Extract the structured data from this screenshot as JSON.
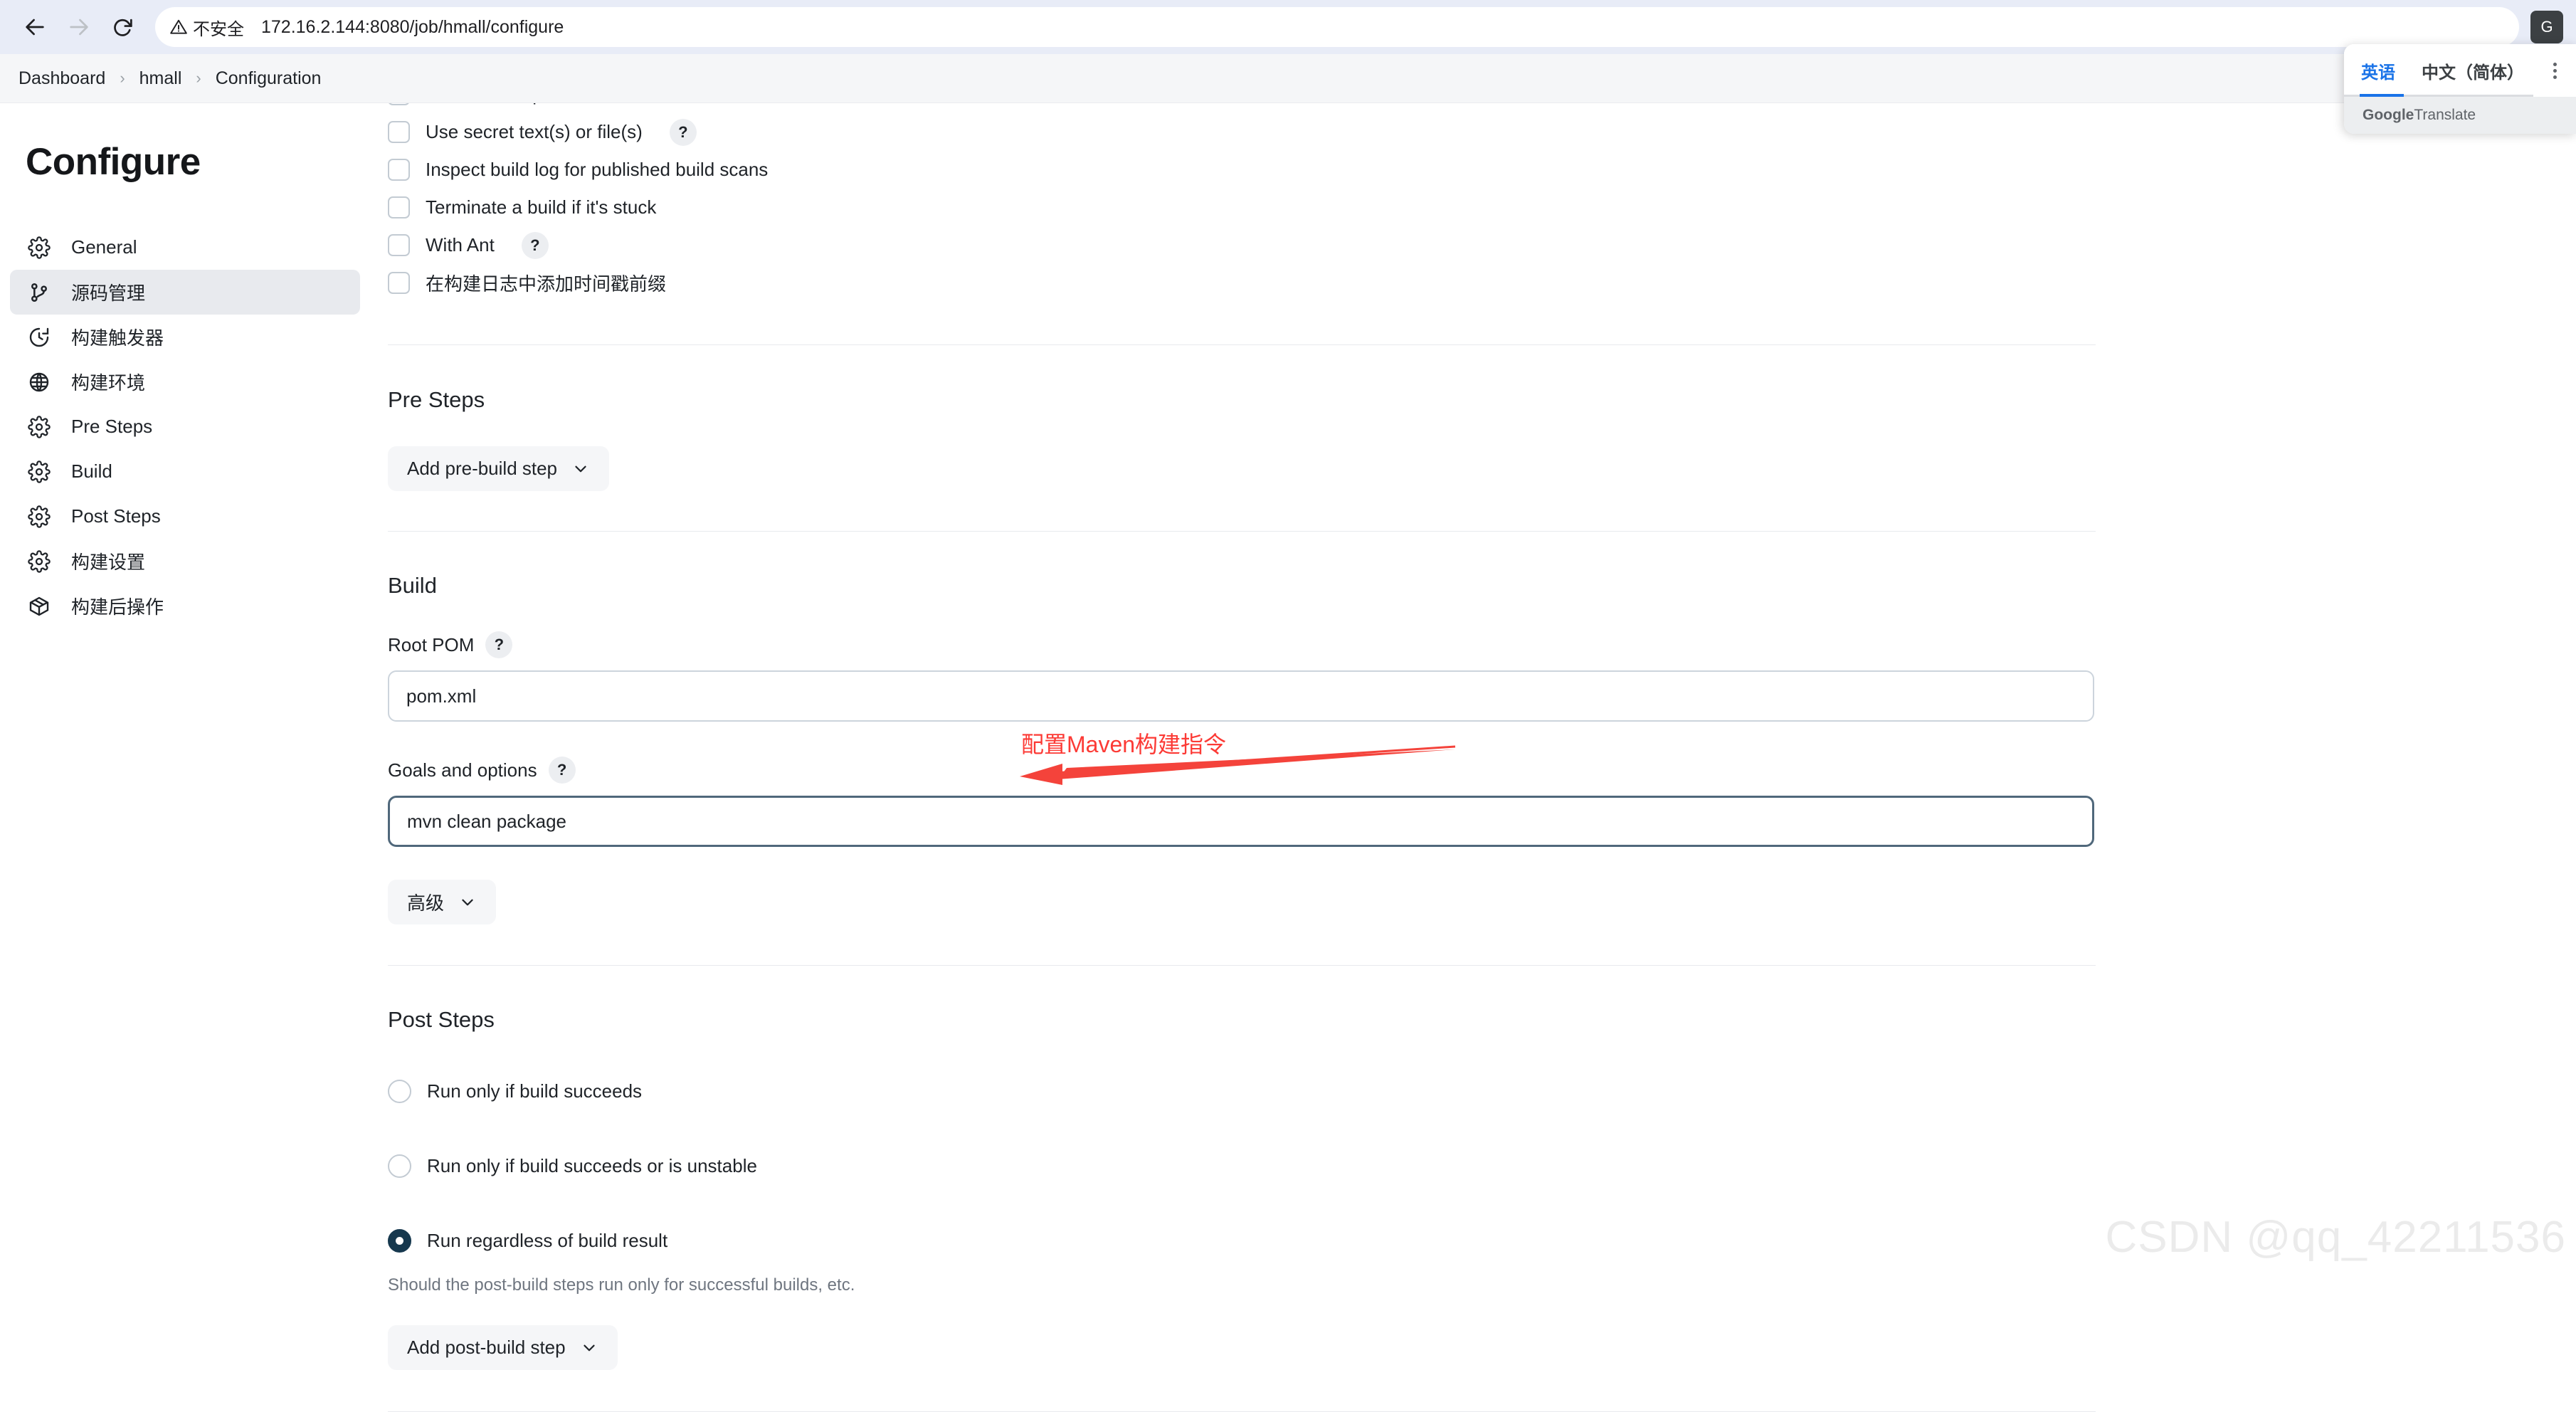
{
  "browser": {
    "back_icon": "back-arrow-icon",
    "forward_icon": "forward-arrow-icon",
    "reload_icon": "reload-icon",
    "security_label": "不安全",
    "security_icon": "warning-triangle-icon",
    "url": "172.16.2.144:8080/job/hmall/configure",
    "profile_initial": "G"
  },
  "breadcrumb": {
    "items": [
      "Dashboard",
      "hmall",
      "Configuration"
    ],
    "separator": "›"
  },
  "sidebar": {
    "title": "Configure",
    "items": [
      {
        "label": "General",
        "icon": "gear-icon",
        "active": false
      },
      {
        "label": "源码管理",
        "icon": "source-branch-icon",
        "active": true
      },
      {
        "label": "构建触发器",
        "icon": "clock-icon",
        "active": false
      },
      {
        "label": "构建环境",
        "icon": "globe-icon",
        "active": false
      },
      {
        "label": "Pre Steps",
        "icon": "gear-icon",
        "active": false
      },
      {
        "label": "Build",
        "icon": "gear-icon",
        "active": false
      },
      {
        "label": "Post Steps",
        "icon": "gear-icon",
        "active": false
      },
      {
        "label": "构建设置",
        "icon": "gear-icon",
        "active": false
      },
      {
        "label": "构建后操作",
        "icon": "package-icon",
        "active": false
      }
    ]
  },
  "build_env": {
    "checkboxes": [
      {
        "label": "Delete workspace before build starts",
        "checked": false,
        "help": false
      },
      {
        "label": "Use secret text(s) or file(s)",
        "checked": false,
        "help": true
      },
      {
        "label": "Inspect build log for published build scans",
        "checked": false,
        "help": false
      },
      {
        "label": "Terminate a build if it's stuck",
        "checked": false,
        "help": false
      },
      {
        "label": "With Ant",
        "checked": false,
        "help": true
      },
      {
        "label": "在构建日志中添加时间戳前缀",
        "checked": false,
        "help": false
      }
    ]
  },
  "pre_steps": {
    "heading": "Pre Steps",
    "add_button": "Add pre-build step",
    "caret_icon": "chevron-down-icon"
  },
  "build": {
    "heading": "Build",
    "root_pom": {
      "label": "Root POM",
      "value": "pom.xml",
      "help": "?"
    },
    "goals": {
      "label": "Goals and options",
      "value": "mvn clean package",
      "help": "?"
    },
    "advanced_button": "高级"
  },
  "post_steps": {
    "heading": "Post Steps",
    "options": [
      {
        "label": "Run only if build succeeds",
        "selected": false
      },
      {
        "label": "Run only if build succeeds or is unstable",
        "selected": false
      },
      {
        "label": "Run regardless of build result",
        "selected": true
      }
    ],
    "hint": "Should the post-build steps run only for successful builds, etc.",
    "add_button": "Add post-build step"
  },
  "annotation": {
    "text": "配置Maven构建指令",
    "color": "#fc3a35"
  },
  "google_translate": {
    "tab_source": "英语",
    "tab_target": "中文（简体）",
    "footer_brand": "Google",
    "footer_name": " Translate",
    "menu_icon": "kebab-menu-icon",
    "accent": "#1a73e8"
  },
  "watermark": "CSDN @qq_42211536",
  "help_symbol": "?"
}
